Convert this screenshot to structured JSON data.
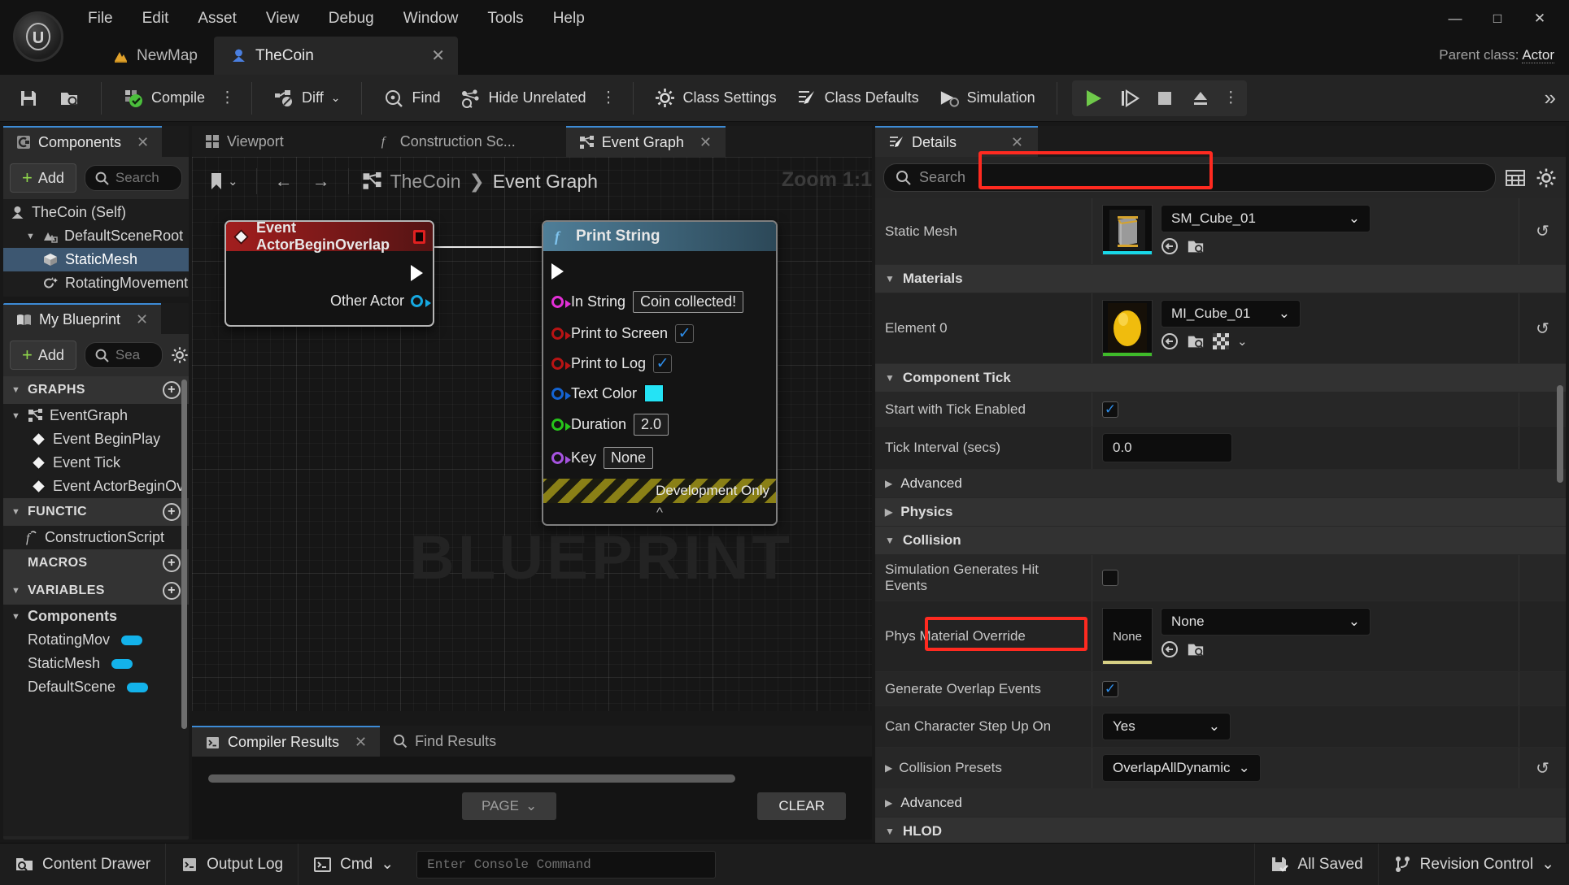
{
  "window": {
    "minimize": "—",
    "maximize": "□",
    "close": "✕",
    "parent_class_label": "Parent class:",
    "parent_class_value": "Actor"
  },
  "menu": {
    "logo": "unreal-engine-logo",
    "items": [
      "File",
      "Edit",
      "Asset",
      "View",
      "Debug",
      "Window",
      "Tools",
      "Help"
    ]
  },
  "tabs": {
    "map_tab": "NewMap",
    "asset_tab": "TheCoin",
    "close_glyph": "✕"
  },
  "toolbar": {
    "save_icon": "save-icon",
    "browse_icon": "browse-content-icon",
    "compile": "Compile",
    "diff": "Diff",
    "find": "Find",
    "hide_unrelated": "Hide Unrelated",
    "class_settings": "Class Settings",
    "class_defaults": "Class Defaults",
    "simulation": "Simulation",
    "kebab": "⋮",
    "chevrons": "»",
    "play": "play-icon",
    "step": "step-icon",
    "stop": "stop-icon",
    "eject": "eject-icon"
  },
  "components_panel": {
    "tab_label": "Components",
    "close": "✕",
    "add_label": "Add",
    "search_placeholder": "Search",
    "tree": [
      {
        "label": "TheCoin (Self)",
        "icon": "actor-icon",
        "indent": 0,
        "selected": false,
        "expander": ""
      },
      {
        "label": "DefaultSceneRoot",
        "icon": "scene-root-icon",
        "indent": 1,
        "selected": false,
        "expander": "▼"
      },
      {
        "label": "StaticMesh",
        "icon": "static-mesh-icon",
        "indent": 2,
        "selected": true,
        "expander": ""
      },
      {
        "label": "RotatingMovement",
        "icon": "rotating-movement-icon",
        "indent": 2,
        "selected": false,
        "expander": ""
      }
    ]
  },
  "myblueprint_panel": {
    "tab_label": "My Blueprint",
    "close": "✕",
    "add_label": "Add",
    "search_placeholder": "Sea",
    "settings_icon": "gear-icon",
    "sections": [
      {
        "title": "GRAPHS",
        "expander": "▼",
        "add": "+",
        "items": [
          {
            "label": "EventGraph",
            "icon": "event-graph-icon",
            "indent": 0,
            "expander": "▼"
          },
          {
            "label": "Event BeginPlay",
            "icon": "event-node-icon",
            "indent": 1,
            "expander": ""
          },
          {
            "label": "Event Tick",
            "icon": "event-node-icon",
            "indent": 1,
            "expander": ""
          },
          {
            "label": "Event ActorBeginOv",
            "icon": "event-node-icon",
            "indent": 1,
            "expander": ""
          }
        ]
      },
      {
        "title": "FUNCTIC",
        "expander": "▼",
        "add": "+",
        "items": [
          {
            "label": "ConstructionScript",
            "icon": "function-icon",
            "indent": 0,
            "expander": ""
          }
        ]
      },
      {
        "title": "MACROS",
        "expander": "",
        "add": "+",
        "items": []
      },
      {
        "title": "VARIABLES",
        "expander": "▼",
        "add": "+",
        "items": [
          {
            "label": "Components",
            "icon": "",
            "indent": 0,
            "expander": "▼",
            "bold": true
          },
          {
            "label": "RotatingMov",
            "icon": "",
            "indent": 1,
            "expander": "",
            "pill": true
          },
          {
            "label": "StaticMesh",
            "icon": "",
            "indent": 1,
            "expander": "",
            "pill": true
          },
          {
            "label": "DefaultScene",
            "icon": "",
            "indent": 1,
            "expander": "",
            "pill": true
          }
        ]
      }
    ]
  },
  "graph": {
    "tabs": [
      {
        "label": "Viewport",
        "icon": "viewport-icon",
        "active": false
      },
      {
        "label": "Construction Sc...",
        "icon": "function-icon",
        "active": false
      },
      {
        "label": "Event Graph",
        "icon": "event-graph-icon",
        "active": true,
        "close": "✕"
      }
    ],
    "bookmark_icon": "bookmark-icon",
    "back_arrow": "←",
    "forward_arrow": "→",
    "breadcrumb_root": "TheCoin",
    "breadcrumb_sep": "❯",
    "breadcrumb_current": "Event Graph",
    "zoom_label": "Zoom 1:1",
    "watermark": "BLUEPRINT",
    "nodes": {
      "event_node": {
        "title": "Event ActorBeginOverlap",
        "icon": "event-node-icon",
        "pins": [
          {
            "name": "",
            "type": "exec-out"
          },
          {
            "name": "Other Actor",
            "type": "object-out"
          }
        ]
      },
      "print_node": {
        "title": "Print String",
        "icon": "function-icon",
        "exec_in": "",
        "footer": "Development Only",
        "pins": [
          {
            "name": "In String",
            "color": "magenta",
            "value": "Coin collected!",
            "widget": "text"
          },
          {
            "name": "Print to Screen",
            "color": "red",
            "value": "✓",
            "widget": "checkbox"
          },
          {
            "name": "Print to Log",
            "color": "red",
            "value": "✓",
            "widget": "checkbox"
          },
          {
            "name": "Text Color",
            "color": "blue",
            "value": "#24e3f5",
            "widget": "color"
          },
          {
            "name": "Duration",
            "color": "green",
            "value": "2.0",
            "widget": "text"
          },
          {
            "name": "Key",
            "color": "purple",
            "value": "None",
            "widget": "text"
          }
        ],
        "collapse": "^"
      }
    }
  },
  "bottom_panel": {
    "tabs": [
      {
        "label": "Compiler Results",
        "icon": "compiler-icon",
        "active": true,
        "close": "✕"
      },
      {
        "label": "Find Results",
        "icon": "search-icon",
        "active": false
      }
    ],
    "page_label": "PAGE",
    "page_chevron": "⌄",
    "clear_label": "CLEAR"
  },
  "details_panel": {
    "tab_label": "Details",
    "close": "✕",
    "search_placeholder": "Search",
    "columns_icon": "columns-icon",
    "settings_icon": "gear-icon",
    "rows": [
      {
        "kind": "prop",
        "name": "Static Mesh",
        "widget": "asset",
        "value": "SM_Cube_01",
        "thumb": "cube-thumbnail",
        "thumb_accent": "#18d8e8",
        "highlight": true,
        "reset": "↺",
        "icons": [
          "browse-to-asset-icon",
          "find-in-content-browser-icon"
        ]
      },
      {
        "kind": "category",
        "name": "Materials",
        "expander": "▼"
      },
      {
        "kind": "prop",
        "name": "Element 0",
        "widget": "asset",
        "value": "MI_Cube_01",
        "thumb": "material-sphere-thumbnail",
        "thumb_accent": "#3fbb2a",
        "highlight": false,
        "reset": "↺",
        "icons": [
          "browse-to-asset-icon",
          "find-in-content-browser-icon",
          "checker-icon"
        ]
      },
      {
        "kind": "category",
        "name": "Component Tick",
        "expander": "▼"
      },
      {
        "kind": "prop",
        "name": "Start with Tick Enabled",
        "widget": "checkbox",
        "value": "✓"
      },
      {
        "kind": "prop",
        "name": "Tick Interval (secs)",
        "widget": "number",
        "value": "0.0"
      },
      {
        "kind": "category_small",
        "name": "Advanced",
        "expander": "▶"
      },
      {
        "kind": "category_small",
        "name": "Physics",
        "expander": "▶"
      },
      {
        "kind": "category",
        "name": "Collision",
        "expander": "▼"
      },
      {
        "kind": "prop",
        "name": "Simulation Generates Hit Events",
        "widget": "checkbox",
        "value": ""
      },
      {
        "kind": "prop",
        "name": "Phys Material Override",
        "widget": "asset",
        "value": "None",
        "thumb": "none-thumbnail",
        "thumb_label": "None",
        "thumb_accent": "#d6cf84",
        "highlight": false,
        "icons": [
          "browse-to-asset-icon",
          "find-in-content-browser-icon"
        ]
      },
      {
        "kind": "prop",
        "name": "Generate Overlap Events",
        "widget": "checkbox",
        "value": "✓"
      },
      {
        "kind": "prop",
        "name": "Can Character Step Up On",
        "widget": "combo",
        "value": "Yes"
      },
      {
        "kind": "prop",
        "name": "Collision Presets",
        "widget": "combo_small",
        "value": "OverlapAllDynamic",
        "expander": "▶",
        "highlight": true,
        "reset": "↺"
      },
      {
        "kind": "category_small",
        "name": "Advanced",
        "expander": "▶"
      },
      {
        "kind": "category",
        "name": "HLOD",
        "expander": "▼"
      }
    ]
  },
  "statusbar": {
    "content_drawer": "Content Drawer",
    "output_log": "Output Log",
    "cmd": "Cmd",
    "cmd_chevron": "⌄",
    "console_placeholder": "Enter Console Command",
    "all_saved": "All Saved",
    "revision_control": "Revision Control",
    "revision_chevron": "⌄"
  },
  "colors": {
    "accent_blue": "#3d8bd6",
    "highlight_red": "#ff2a20",
    "green_plus": "#8ed44b",
    "pin_cyan": "#13b2ea"
  }
}
